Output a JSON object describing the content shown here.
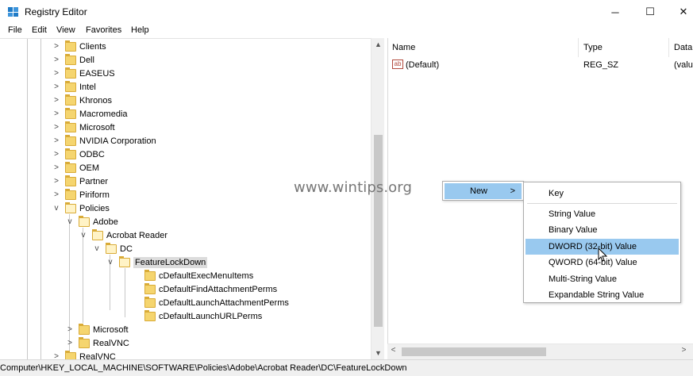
{
  "window": {
    "title": "Registry Editor",
    "minimize": "─",
    "maximize": "☐",
    "close": "✕"
  },
  "menu": [
    "File",
    "Edit",
    "View",
    "Favorites",
    "Help"
  ],
  "tree": {
    "items": [
      {
        "label": "Clients",
        "chevron": ">",
        "indent": 0
      },
      {
        "label": "Dell",
        "chevron": ">",
        "indent": 0
      },
      {
        "label": "EASEUS",
        "chevron": ">",
        "indent": 0
      },
      {
        "label": "Intel",
        "chevron": ">",
        "indent": 0
      },
      {
        "label": "Khronos",
        "chevron": ">",
        "indent": 0
      },
      {
        "label": "Macromedia",
        "chevron": ">",
        "indent": 0
      },
      {
        "label": "Microsoft",
        "chevron": ">",
        "indent": 0
      },
      {
        "label": "NVIDIA Corporation",
        "chevron": ">",
        "indent": 0
      },
      {
        "label": "ODBC",
        "chevron": ">",
        "indent": 0
      },
      {
        "label": "OEM",
        "chevron": ">",
        "indent": 0
      },
      {
        "label": "Partner",
        "chevron": ">",
        "indent": 0
      },
      {
        "label": "Piriform",
        "chevron": ">",
        "indent": 0
      },
      {
        "label": "Policies",
        "chevron": "v",
        "indent": 0
      },
      {
        "label": "Adobe",
        "chevron": "v",
        "indent": 1
      },
      {
        "label": "Acrobat Reader",
        "chevron": "v",
        "indent": 2
      },
      {
        "label": "DC",
        "chevron": "v",
        "indent": 3
      },
      {
        "label": "FeatureLockDown",
        "chevron": "v",
        "indent": 4,
        "selected": true
      },
      {
        "label": "cDefaultExecMenuItems",
        "chevron": "",
        "indent": 5
      },
      {
        "label": "cDefaultFindAttachmentPerms",
        "chevron": "",
        "indent": 5
      },
      {
        "label": "cDefaultLaunchAttachmentPerms",
        "chevron": "",
        "indent": 5
      },
      {
        "label": "cDefaultLaunchURLPerms",
        "chevron": "",
        "indent": 5
      },
      {
        "label": "Microsoft",
        "chevron": ">",
        "indent": 1
      },
      {
        "label": "RealVNC",
        "chevron": ">",
        "indent": 1
      },
      {
        "label": "RealVNC",
        "chevron": ">",
        "indent": 0
      }
    ],
    "scroll_up": "▲",
    "scroll_down": "▼"
  },
  "values": {
    "columns": [
      "Name",
      "Type",
      "Data"
    ],
    "rows": [
      {
        "name": "(Default)",
        "type": "REG_SZ",
        "data": "(valu"
      }
    ],
    "scroll_left": "<",
    "scroll_right": ">"
  },
  "context_menu": {
    "new_label": "New",
    "new_arrow": ">",
    "submenu": [
      "Key",
      "String Value",
      "Binary Value",
      "DWORD (32-bit) Value",
      "QWORD (64-bit) Value",
      "Multi-String Value",
      "Expandable String Value"
    ],
    "highlighted": "DWORD (32-bit) Value"
  },
  "status": "Computer\\HKEY_LOCAL_MACHINE\\SOFTWARE\\Policies\\Adobe\\Acrobat Reader\\DC\\FeatureLockDown",
  "watermark": "www.wintips.org",
  "colors": {
    "menu_highlight": "#99c9ef",
    "folder": "#f5d56f",
    "selection_grey": "#dcdcdc"
  },
  "icons": {
    "app": "registry-editor-icon",
    "folder": "folder-icon",
    "value": "string-value-icon"
  }
}
